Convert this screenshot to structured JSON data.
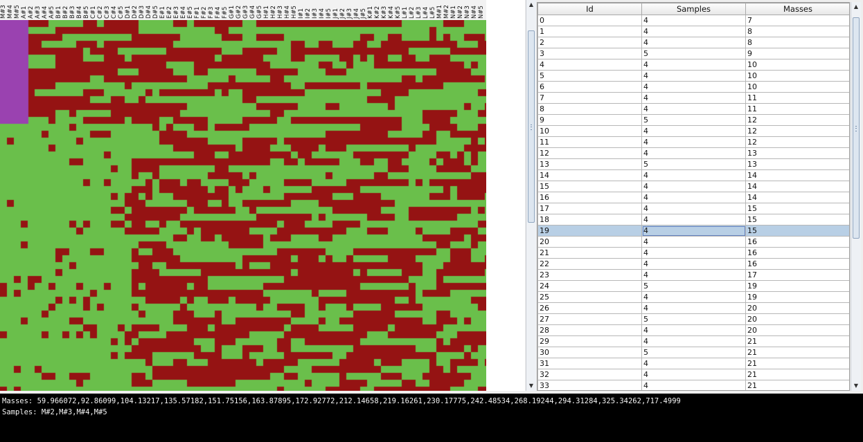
{
  "heatmap": {
    "columns": [
      "M#3",
      "M#4",
      "M#5",
      "A#1",
      "A#2",
      "A#3",
      "A#4",
      "A#5",
      "B#1",
      "B#2",
      "B#3",
      "B#4",
      "B#5",
      "C#1",
      "C#2",
      "C#3",
      "C#4",
      "C#5",
      "D#1",
      "D#2",
      "D#3",
      "D#4",
      "D#5",
      "E#1",
      "E#2",
      "E#3",
      "E#4",
      "E#5",
      "F#1",
      "F#2",
      "F#3",
      "F#4",
      "F#5",
      "G#1",
      "G#2",
      "G#3",
      "G#4",
      "G#5",
      "H#1",
      "H#2",
      "H#3",
      "H#4",
      "H#5",
      "I#1",
      "I#2",
      "I#3",
      "I#4",
      "I#5",
      "J#1",
      "J#2",
      "J#3",
      "J#4",
      "J#5",
      "K#1",
      "K#2",
      "K#3",
      "K#4",
      "K#5",
      "L#1",
      "L#2",
      "L#3",
      "L#4",
      "L#5",
      "M#1",
      "M#2",
      "N#1",
      "N#2",
      "N#3",
      "N#4",
      "N#5"
    ],
    "colors": {
      "present": "#951313",
      "absent": "#6abf4b",
      "selected_sample": "#9a42b0"
    },
    "selected_columns": [
      "M#3",
      "M#4",
      "M#5"
    ]
  },
  "table": {
    "headers": [
      "Id",
      "Samples",
      "Masses"
    ],
    "selected_id": "19",
    "rows": [
      [
        "0",
        "4",
        "7"
      ],
      [
        "1",
        "4",
        "8"
      ],
      [
        "2",
        "4",
        "8"
      ],
      [
        "3",
        "5",
        "9"
      ],
      [
        "4",
        "4",
        "10"
      ],
      [
        "5",
        "4",
        "10"
      ],
      [
        "6",
        "4",
        "10"
      ],
      [
        "7",
        "4",
        "11"
      ],
      [
        "8",
        "4",
        "11"
      ],
      [
        "9",
        "5",
        "12"
      ],
      [
        "10",
        "4",
        "12"
      ],
      [
        "11",
        "4",
        "12"
      ],
      [
        "12",
        "4",
        "13"
      ],
      [
        "13",
        "5",
        "13"
      ],
      [
        "14",
        "4",
        "14"
      ],
      [
        "15",
        "4",
        "14"
      ],
      [
        "16",
        "4",
        "14"
      ],
      [
        "17",
        "4",
        "15"
      ],
      [
        "18",
        "4",
        "15"
      ],
      [
        "19",
        "4",
        "15"
      ],
      [
        "20",
        "4",
        "16"
      ],
      [
        "21",
        "4",
        "16"
      ],
      [
        "22",
        "4",
        "16"
      ],
      [
        "23",
        "4",
        "17"
      ],
      [
        "24",
        "5",
        "19"
      ],
      [
        "25",
        "4",
        "19"
      ],
      [
        "26",
        "4",
        "20"
      ],
      [
        "27",
        "5",
        "20"
      ],
      [
        "28",
        "4",
        "20"
      ],
      [
        "29",
        "4",
        "21"
      ],
      [
        "30",
        "5",
        "21"
      ],
      [
        "31",
        "4",
        "21"
      ],
      [
        "32",
        "4",
        "21"
      ],
      [
        "33",
        "4",
        "21"
      ]
    ]
  },
  "console": {
    "masses_line": "Masses:  59.966072,92.86099,104.13217,135.57182,151.75156,163.87895,172.92772,212.14658,219.16261,230.17775,242.48534,268.19244,294.31284,325.34262,717.4999",
    "samples_line": "Samples: M#2,M#3,M#4,M#5"
  },
  "icons": {
    "scroll_up": "up-arrow-icon",
    "scroll_down": "down-arrow-icon",
    "grip": "scroll-grip-icon"
  }
}
